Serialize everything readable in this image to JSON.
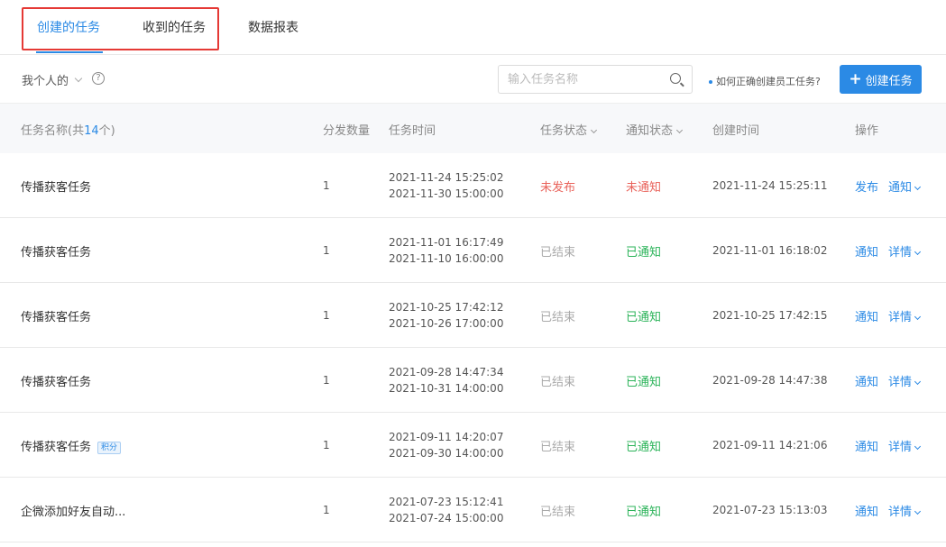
{
  "tabs": [
    {
      "label": "创建的任务",
      "active": true
    },
    {
      "label": "收到的任务",
      "active": false
    },
    {
      "label": "数据报表",
      "active": false
    }
  ],
  "toolbar": {
    "scope_label": "我个人的",
    "help_symbol": "?",
    "search_placeholder": "输入任务名称",
    "howto_link": "如何正确创建员工任务?",
    "create_label": "创建任务",
    "create_icon": "+"
  },
  "table": {
    "headers": {
      "name_prefix": "任务名称(共",
      "name_count": "14",
      "name_suffix": "个)",
      "quantity": "分发数量",
      "time": "任务时间",
      "status": "任务状态",
      "notify": "通知状态",
      "created": "创建时间",
      "ops": "操作"
    },
    "rows": [
      {
        "name": "传播获客任务",
        "badge": "",
        "quantity": "1",
        "start": "2021-11-24 15:25:02",
        "end": "2021-11-30 15:00:00",
        "status": "未发布",
        "status_type": "unpub",
        "notify": "未通知",
        "notify_type": "no",
        "created": "2021-11-24 15:25:11",
        "op1": "发布",
        "op2": "通知"
      },
      {
        "name": "传播获客任务",
        "badge": "",
        "quantity": "1",
        "start": "2021-11-01 16:17:49",
        "end": "2021-11-10 16:00:00",
        "status": "已结束",
        "status_type": "done",
        "notify": "已通知",
        "notify_type": "yes",
        "created": "2021-11-01 16:18:02",
        "op1": "通知",
        "op2": "详情"
      },
      {
        "name": "传播获客任务",
        "badge": "",
        "quantity": "1",
        "start": "2021-10-25 17:42:12",
        "end": "2021-10-26 17:00:00",
        "status": "已结束",
        "status_type": "done",
        "notify": "已通知",
        "notify_type": "yes",
        "created": "2021-10-25 17:42:15",
        "op1": "通知",
        "op2": "详情"
      },
      {
        "name": "传播获客任务",
        "badge": "",
        "quantity": "1",
        "start": "2021-09-28 14:47:34",
        "end": "2021-10-31 14:00:00",
        "status": "已结束",
        "status_type": "done",
        "notify": "已通知",
        "notify_type": "yes",
        "created": "2021-09-28 14:47:38",
        "op1": "通知",
        "op2": "详情"
      },
      {
        "name": "传播获客任务",
        "badge": "积分",
        "quantity": "1",
        "start": "2021-09-11 14:20:07",
        "end": "2021-09-30 14:00:00",
        "status": "已结束",
        "status_type": "done",
        "notify": "已通知",
        "notify_type": "yes",
        "created": "2021-09-11 14:21:06",
        "op1": "通知",
        "op2": "详情"
      },
      {
        "name": "企微添加好友自动...",
        "badge": "",
        "quantity": "1",
        "start": "2021-07-23 15:12:41",
        "end": "2021-07-24 15:00:00",
        "status": "已结束",
        "status_type": "done",
        "notify": "已通知",
        "notify_type": "yes",
        "created": "2021-07-23 15:13:03",
        "op1": "通知",
        "op2": "详情"
      }
    ]
  },
  "colors": {
    "accent": "#2b8ae5",
    "danger": "#e9625a",
    "success": "#2bb359",
    "highlight_border": "#e53935"
  }
}
